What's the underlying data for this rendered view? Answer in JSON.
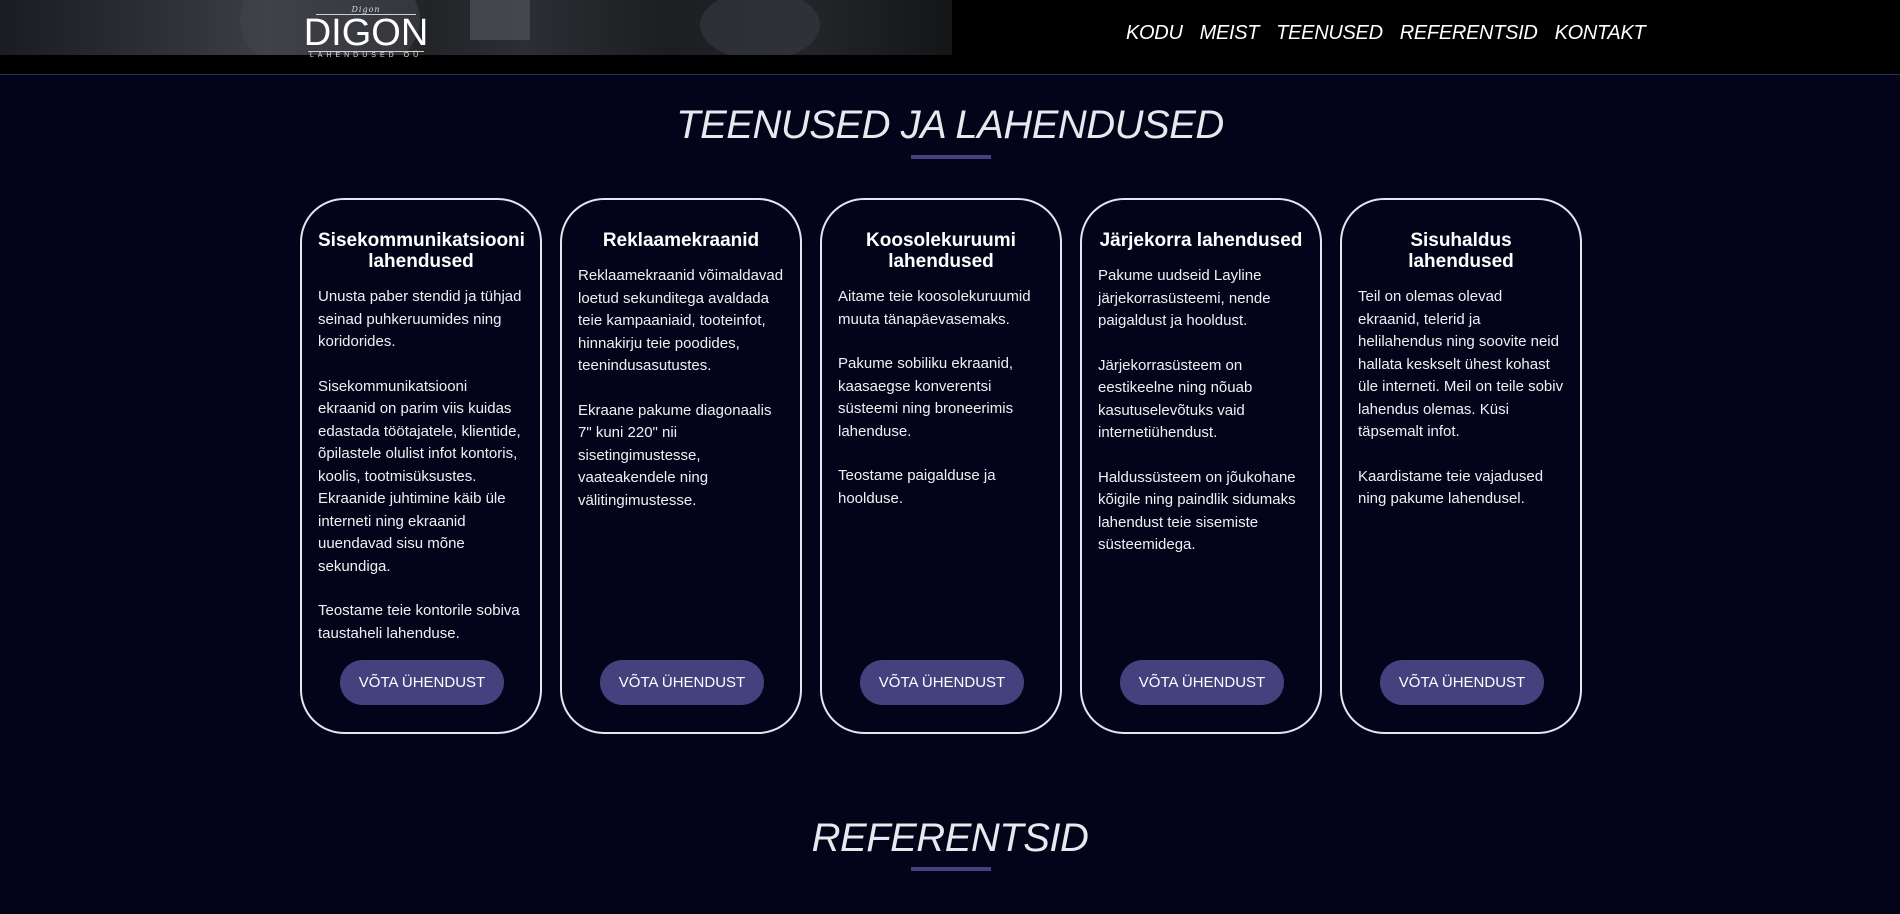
{
  "header": {
    "logo": {
      "script_text": "Digon",
      "name": "DIGON",
      "subtitle": "LAHENDUSED OÜ"
    },
    "nav": [
      "KODU",
      "MEIST",
      "TEENUSED",
      "REFERENTSID",
      "KONTAKT"
    ]
  },
  "services": {
    "title": "TEENUSED JA LAHENDUSED",
    "cards": [
      {
        "title": "Sisekommunikatsiooni lahendused",
        "paragraphs": [
          "Unusta paber stendid ja tühjad seinad puhkeruumides ning koridorides.",
          "Sisekommunikatsiooni ekraanid on parim viis kuidas edastada töötajatele, klientide, õpilastele olulist infot kontoris, koolis, tootmisüksustes. Ekraanide juhtimine käib üle interneti ning ekraanid uuendavad sisu mõne sekundiga.",
          "Teostame teie kontorile sobiva taustaheli lahenduse."
        ],
        "button": "VÕTA ÜHENDUST"
      },
      {
        "title": "Reklaamekraanid",
        "paragraphs": [
          "Reklaamekraanid võimaldavad loetud sekunditega avaldada teie kampaaniaid, tooteinfot, hinnakirju teie poodides, teenindusasutustes.",
          "Ekraane pakume diagonaalis 7\" kuni 220\" nii sisetingimustesse, vaateakendele ning välitingimustesse."
        ],
        "button": "VÕTA ÜHENDUST"
      },
      {
        "title": "Koosolekuruumi lahendused",
        "paragraphs": [
          "Aitame teie koosolekuruumid muuta tänapäevasemaks.",
          "Pakume sobiliku ekraanid, kaasaegse konverentsi süsteemi ning broneerimis lahenduse.",
          "Teostame paigalduse ja hoolduse."
        ],
        "button": "VÕTA ÜHENDUST"
      },
      {
        "title": "Järjekorra lahendused",
        "paragraphs": [
          "Pakume uudseid Layline järjekorrasüsteemi, nende paigaldust ja hooldust.",
          "Järjekorrasüsteem on eestikeelne ning nõuab kasutuselevõtuks vaid internetiühendust.",
          "Haldussüsteem on jõukohane kõigile ning paindlik sidumaks lahendust teie sisemiste süsteemidega."
        ],
        "button": "VÕTA ÜHENDUST"
      },
      {
        "title": "Sisuhaldus lahendused",
        "paragraphs": [
          "Teil on olemas olevad ekraanid, telerid ja helilahendus ning soovite neid hallata keskselt ühest kohast üle interneti. Meil on teile sobiv lahendus olemas. Küsi täpsemalt infot.",
          "Kaardistame teie vajadused ning pakume lahendusel."
        ],
        "button": "VÕTA ÜHENDUST"
      }
    ]
  },
  "references": {
    "title": "REFERENTSID"
  }
}
